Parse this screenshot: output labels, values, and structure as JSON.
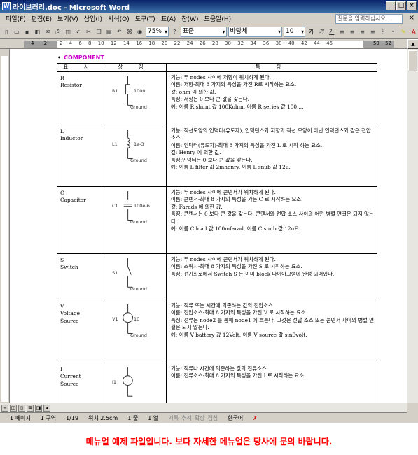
{
  "window": {
    "title": "라이브러리.doc - Microsoft Word"
  },
  "menu": [
    "파일(F)",
    "편집(E)",
    "보기(V)",
    "삽입(I)",
    "서식(O)",
    "도구(T)",
    "표(A)",
    "창(W)",
    "도움말(H)"
  ],
  "help_placeholder": "질문을 입력하십시오.",
  "toolbar": {
    "zoom": "75%",
    "style": "표준",
    "font": "바탕체",
    "size": "10",
    "bold": "가",
    "italic": "가",
    "underline": "가"
  },
  "ruler": {
    "left_ticks": "4 2",
    "ticks": "2 4 6 8 10 12 14 16 18 20 22 24 26 28 30 32 34 36 38 40 42 44 46",
    "right_ticks": "50 52"
  },
  "document": {
    "heading": "COMPONENT",
    "columns": [
      "표 시",
      "상 징",
      "특 징"
    ],
    "rows": [
      {
        "name": "R",
        "en": "Resistor",
        "sym_label": "R1",
        "sym_value": "1000",
        "ground": "Ground",
        "lines": [
          "기능: 두 nodes 사이에 저항이 위치하게 된다.",
          "이름: 저항-최대 8 가지의 특성을 가진 R로 시작하는 요소.",
          "값: ohm 이 의한 값.",
          "특징: 저항은 0 보다 큰 값을 갖는다.",
          "예: 이름 R shunt 값 100Kohm, 이름 R series 값 100...."
        ]
      },
      {
        "name": "L",
        "en": "Inductor",
        "sym_label": "L1",
        "sym_value": "1e-3",
        "ground": "Ground",
        "lines": [
          "기능: 직선모양의 인덕터(유도자), 인덕턴스와 저항과 직선 모양이 아닌 인덕턴스와 같은 전압 소스.",
          "이름: 인덕터(유도자)-최대 8 가지의 특성을 가진 L 로 시작 하는 요소.",
          "값: Henry 에 의한 값.",
          "특징:인덕터는 0 보다 큰 값을 갖는다.",
          "예: 이름 L filter 값 2mhenry, 이름 L snub 값 12u."
        ]
      },
      {
        "name": "C",
        "en": "Capacitor",
        "sym_label": "C1",
        "sym_value": "100e-6",
        "ground": "Ground",
        "lines": [
          "기능: 두 nodes 사이에 콘덴서가 위치하게 된다.",
          "이름: 콘덴서-최대 8 가지의 특성을 가는 C 로 시작하는 요소.",
          "값: Farads 에 의한 값.",
          "특징: 콘덴서는 0 보다 큰 값을 갖는다. 콘덴서와 전압 소스 사이의 어떤 병렬 연결은 되지 않는다.",
          "예: 이름 C load 값 100mfarad, 이름 C snub 값 12uF."
        ]
      },
      {
        "name": "S",
        "en": "Switch",
        "sym_label": "S1",
        "sym_value": "",
        "ground": "Ground",
        "lines": [
          "기능: 두 nodes 사이에 콘덴서가 위치하게 된다.",
          "이름: 스위치-최대 8 가지의 특성을 가진 S 로 시작하는 요소.",
          "특징: 전기회로에서 Switch S 는 이미 block 다이아그램에 완성 되어있다."
        ]
      },
      {
        "name": "V",
        "en": "Voltage Source",
        "sym_label": "V1",
        "sym_value": "10",
        "ground": "Ground",
        "lines": [
          "기능: 직류 또는 시간에 의존하는 값의 전압소스.",
          "이름: 전압소스-최대 8 가지의 특성을 가진 V 로 시작하는 요소.",
          "특징: 전류는 node2 를 통해 node1 에 흐른다. 그것은 전압 소스 또는 콘덴서 사이의 병렬 연결은 되지 않는다.",
          "예: 이름 V battery 값 12Volt, 이름 V source 값 sin9volt."
        ]
      },
      {
        "name": "I",
        "en": "Current Source",
        "sym_label": "I1",
        "sym_value": "",
        "ground": "",
        "lines": [
          "기능: 직류나 시간에 의존하는 값의 전류소스.",
          "이름: 전류소스-최대 8 가지의 특성을 가진 I 로 시작하는 요소."
        ]
      }
    ]
  },
  "status": {
    "page": "1 페이지",
    "section": "1 구역",
    "pages": "1/19",
    "pos": "위치 2.5cm",
    "line": "1 줄",
    "col": "1 열",
    "rec": "기록",
    "trk": "추적",
    "ext": "확장",
    "ovr": "겹침",
    "lang": "한국어"
  },
  "notice": "메뉴얼 예제 파일입니다. 보다 자세한 메뉴얼은 당사에 문의 바랍니다."
}
